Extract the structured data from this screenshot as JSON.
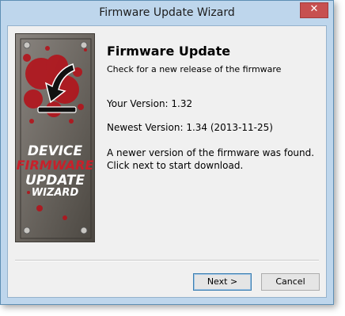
{
  "window": {
    "title": "Firmware Update Wizard",
    "close_glyph": "✕"
  },
  "side_panel": {
    "brand_lines": [
      "DEVICE",
      "FIRMWARE",
      "UPDATE",
      "WIZARD"
    ],
    "colors": {
      "panel": "#5a5650",
      "splatter": "#b3141c",
      "accent_red": "#c8202a"
    }
  },
  "content": {
    "heading": "Firmware Update",
    "subheading": "Check for a new release of the firmware",
    "your_version": "Your Version: 1.32",
    "newest_version": "Newest Version: 1.34 (2013-11-25)",
    "message_line1": "A newer version of the firmware was found.",
    "message_line2": "Click next to start download."
  },
  "buttons": {
    "next": "Next >",
    "cancel": "Cancel"
  }
}
